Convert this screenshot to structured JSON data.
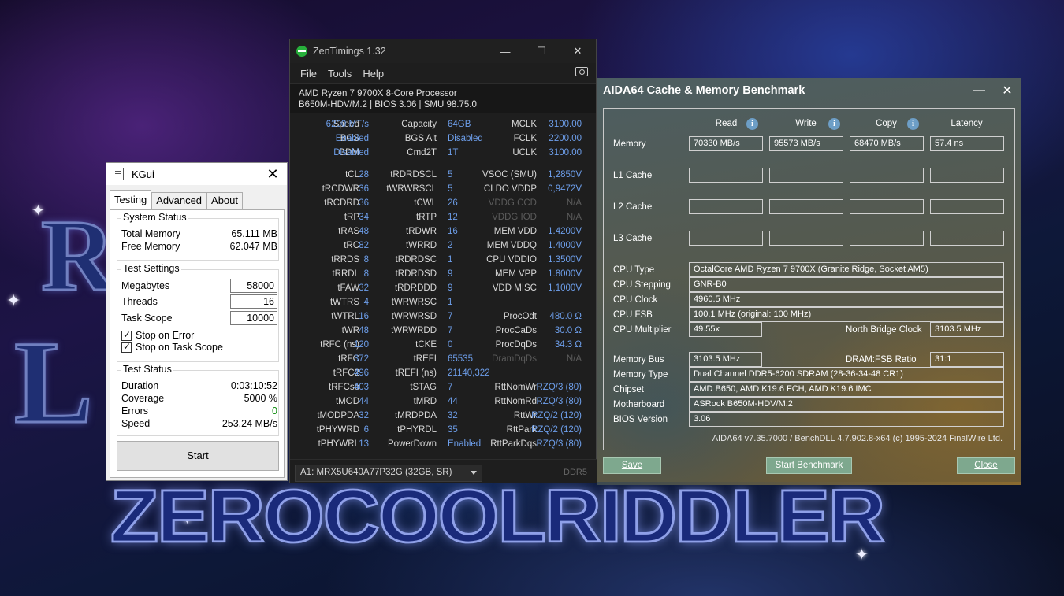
{
  "kgui": {
    "title": "KGui",
    "tabs": [
      "Testing",
      "Advanced",
      "About"
    ],
    "system_status": {
      "title": "System Status",
      "rows": [
        {
          "label": "Total Memory",
          "value": "65.111 MB"
        },
        {
          "label": "Free Memory",
          "value": "62.047 MB"
        }
      ]
    },
    "test_settings": {
      "title": "Test Settings",
      "fields": [
        {
          "label": "Megabytes",
          "value": "58000"
        },
        {
          "label": "Threads",
          "value": "16"
        },
        {
          "label": "Task Scope",
          "value": "10000"
        }
      ],
      "checks": [
        {
          "label": "Stop on Error",
          "checked": true
        },
        {
          "label": "Stop on Task Scope",
          "checked": true
        }
      ]
    },
    "test_status": {
      "title": "Test Status",
      "rows": [
        {
          "label": "Duration",
          "value": "0:03:10:52"
        },
        {
          "label": "Coverage",
          "value": "5000 %"
        },
        {
          "label": "Errors",
          "value": "0"
        },
        {
          "label": "Speed",
          "value": "253.24 MB/s"
        }
      ]
    },
    "start_label": "Start"
  },
  "zentimings": {
    "title": "ZenTimings 1.32",
    "menu": [
      "File",
      "Tools",
      "Help"
    ],
    "cpu": "AMD Ryzen 7 9700X 8-Core Processor",
    "board": "B650M-HDV/M.2 | BIOS 3.06 | SMU 98.75.0",
    "rows": [
      [
        [
          "Speed",
          "6200 MT/s"
        ],
        [
          "Capacity",
          "64GB"
        ],
        [
          "MCLK",
          "3100.00"
        ]
      ],
      [
        [
          "BGS",
          "Enabled"
        ],
        [
          "BGS Alt",
          "Disabled"
        ],
        [
          "FCLK",
          "2200.00"
        ]
      ],
      [
        [
          "GDM",
          "Disabled"
        ],
        [
          "Cmd2T",
          "1T"
        ],
        [
          "UCLK",
          "3100.00"
        ]
      ],
      [
        [
          "tCL",
          "28"
        ],
        [
          "tRDRDSCL",
          "5"
        ],
        [
          "VSOC (SMU)",
          "1,2850V"
        ]
      ],
      [
        [
          "tRCDWR",
          "36"
        ],
        [
          "tWRWRSCL",
          "5"
        ],
        [
          "CLDO VDDP",
          "0,9472V"
        ]
      ],
      [
        [
          "tRCDRD",
          "36"
        ],
        [
          "tCWL",
          "26"
        ],
        [
          "VDDG CCD",
          "N/A"
        ]
      ],
      [
        [
          "tRP",
          "34"
        ],
        [
          "tRTP",
          "12"
        ],
        [
          "VDDG IOD",
          "N/A"
        ]
      ],
      [
        [
          "tRAS",
          "48"
        ],
        [
          "tRDWR",
          "16"
        ],
        [
          "MEM VDD",
          "1.4200V"
        ]
      ],
      [
        [
          "tRC",
          "82"
        ],
        [
          "tWRRD",
          "2"
        ],
        [
          "MEM VDDQ",
          "1.4000V"
        ]
      ],
      [
        [
          "tRRDS",
          "8"
        ],
        [
          "tRDRDSC",
          "1"
        ],
        [
          "CPU VDDIO",
          "1.3500V"
        ]
      ],
      [
        [
          "tRRDL",
          "8"
        ],
        [
          "tRDRDSD",
          "9"
        ],
        [
          "MEM VPP",
          "1.8000V"
        ]
      ],
      [
        [
          "tFAW",
          "32"
        ],
        [
          "tRDRDDD",
          "9"
        ],
        [
          "VDD MISC",
          "1,1000V"
        ]
      ],
      [
        [
          "tWTRS",
          "4"
        ],
        [
          "tWRWRSC",
          "1"
        ],
        [
          "",
          ""
        ]
      ],
      [
        [
          "tWTRL",
          "16"
        ],
        [
          "tWRWRSD",
          "7"
        ],
        [
          "ProcOdt",
          "480.0 Ω"
        ]
      ],
      [
        [
          "tWR",
          "48"
        ],
        [
          "tWRWRDD",
          "7"
        ],
        [
          "ProcCaDs",
          "30.0 Ω"
        ]
      ],
      [
        [
          "tRFC (ns)",
          "120"
        ],
        [
          "tCKE",
          "0"
        ],
        [
          "ProcDqDs",
          "34.3 Ω"
        ]
      ],
      [
        [
          "tRFC",
          "372"
        ],
        [
          "tREFI",
          "65535"
        ],
        [
          "DramDqDs",
          "N/A"
        ]
      ],
      [
        [
          "tRFC2",
          "496"
        ],
        [
          "tREFI (ns)",
          "21140,322"
        ],
        [
          "",
          ""
        ]
      ],
      [
        [
          "tRFCsb",
          "403"
        ],
        [
          "tSTAG",
          "7"
        ],
        [
          "RttNomWr",
          "RZQ/3 (80)"
        ]
      ],
      [
        [
          "tMOD",
          "44"
        ],
        [
          "tMRD",
          "44"
        ],
        [
          "RttNomRd",
          "RZQ/3 (80)"
        ]
      ],
      [
        [
          "tMODPDA",
          "32"
        ],
        [
          "tMRDPDA",
          "32"
        ],
        [
          "RttWr",
          "RZQ/2 (120)"
        ]
      ],
      [
        [
          "tPHYWRD",
          "6"
        ],
        [
          "tPHYRDL",
          "35"
        ],
        [
          "RttPark",
          "RZQ/2 (120)"
        ]
      ],
      [
        [
          "tPHYWRL",
          "13"
        ],
        [
          "PowerDown",
          "Enabled"
        ],
        [
          "RttParkDqs",
          "RZQ/3 (80)"
        ]
      ]
    ],
    "dimm_select": "A1: MRX5U640A77P32G (32GB, SR)",
    "ddr_label": "DDR5"
  },
  "aida": {
    "title": "AIDA64 Cache & Memory Benchmark",
    "columns": [
      "Read",
      "Write",
      "Copy",
      "Latency"
    ],
    "bench_rows": [
      {
        "label": "Memory",
        "values": [
          "70330 MB/s",
          "95573 MB/s",
          "68470 MB/s",
          "57.4 ns"
        ]
      },
      {
        "label": "L1 Cache",
        "values": [
          "",
          "",
          "",
          ""
        ]
      },
      {
        "label": "L2 Cache",
        "values": [
          "",
          "",
          "",
          ""
        ]
      },
      {
        "label": "L3 Cache",
        "values": [
          "",
          "",
          "",
          ""
        ]
      }
    ],
    "cpu_type_label": "CPU Type",
    "cpu_type": "OctalCore AMD Ryzen 7 9700X  (Granite Ridge, Socket AM5)",
    "cpu_stepping_label": "CPU Stepping",
    "cpu_stepping": "GNR-B0",
    "cpu_clock_label": "CPU Clock",
    "cpu_clock": "4960.5 MHz",
    "cpu_fsb_label": "CPU FSB",
    "cpu_fsb": "100.1 MHz  (original: 100 MHz)",
    "cpu_multiplier_label": "CPU Multiplier",
    "cpu_multiplier": "49.55x",
    "nb_clock_label": "North Bridge Clock",
    "nb_clock": "3103.5 MHz",
    "memory_bus_label": "Memory Bus",
    "memory_bus": "3103.5 MHz",
    "dram_ratio_label": "DRAM:FSB Ratio",
    "dram_ratio": "31:1",
    "memory_type_label": "Memory Type",
    "memory_type": "Dual Channel DDR5-6200 SDRAM  (28-36-34-48 CR1)",
    "chipset_label": "Chipset",
    "chipset": "AMD B650, AMD K19.6 FCH, AMD K19.6 IMC",
    "motherboard_label": "Motherboard",
    "motherboard": "ASRock B650M-HDV/M.2",
    "bios_label": "BIOS Version",
    "bios": "3.06",
    "footer": "AIDA64 v7.35.7000 / BenchDLL 4.7.902.8-x64  (c) 1995-2024 FinalWire Ltd.",
    "save_label": "Save",
    "start_label": "Start Benchmark",
    "close_label": "Close"
  },
  "wallpaper": {
    "wordmark": "ZEROCOOLRIDDLER"
  }
}
